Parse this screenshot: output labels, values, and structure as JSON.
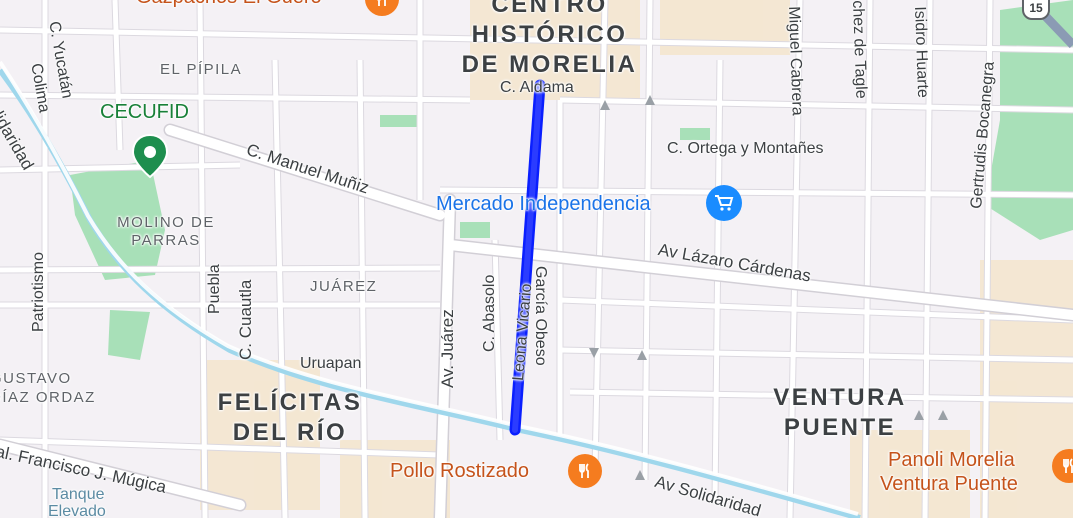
{
  "map": {
    "colors": {
      "background": "#f4f1f5",
      "road": "#ffffff",
      "road_casing": "#d9d6dd",
      "canal": "#a8dcef",
      "park": "#a8e0b8",
      "route": "#0a1fff",
      "food_pin": "#f57c1f",
      "shop_pin": "#1a8cff",
      "park_pin": "#1e8e4e"
    },
    "neighborhoods": {
      "centro": "CENTRO HISTÓRICO DE MORELIA",
      "el_pipila": "EL PÍPILA",
      "molino": "MOLINO DE PARRAS",
      "juarez": "JUÁREZ",
      "felicitas": "FELÍCITAS DEL RÍO",
      "ventura": "VENTURA PUENTE",
      "gustavo": "GUSTAVO DÍAZ ORDAZ"
    },
    "streets": {
      "aldama": "C. Aldama",
      "manuel_muniz": "C. Manuel Muñiz",
      "ortega": "C. Ortega y Montañes",
      "lazaro": "Av Lázaro Cárdenas",
      "juarez_av": "Av. Juárez",
      "abasolo": "C. Abasolo",
      "leona": "Leona Vicario",
      "garcia_obeso": "García Obeso",
      "uruapan": "Uruapan",
      "solidaridad_1": "Av Solidaridad",
      "solidaridad_2": "Solidaridad",
      "mugica": "al. Francisco J. Múgica",
      "cuautla": "C. Cuautla",
      "puebla": "Puebla",
      "patriotismo": "Patriotismo",
      "yucatan": "C. Yucatán",
      "colima": "Colima",
      "miguel_cabrera": "Miguel Cabrera",
      "sanchez_tagle": "chez de Tagle",
      "isidro_huarte": "Isidro Huarte",
      "gertrudis": "Gertrudis Bocanegra",
      "highway": "15"
    },
    "pois": {
      "gazpachos": {
        "label": "Gazpachos El Güero",
        "icon": "restaurant-icon"
      },
      "cecufid": {
        "label": "CECUFID",
        "icon": "park-pin-icon"
      },
      "mercado": {
        "label": "Mercado Independencia",
        "icon": "shopping-cart-icon"
      },
      "pollo": {
        "label": "Pollo Rostizado",
        "icon": "restaurant-icon"
      },
      "panoli": {
        "label": "Panoli Morelia Ventura Puente",
        "line1": "Panoli Morelia",
        "line2": "Ventura Puente",
        "icon": "restaurant-icon"
      },
      "tanque": {
        "label": "Tanque Elevado",
        "line1": "Tanque",
        "line2": "Elevado"
      }
    }
  }
}
